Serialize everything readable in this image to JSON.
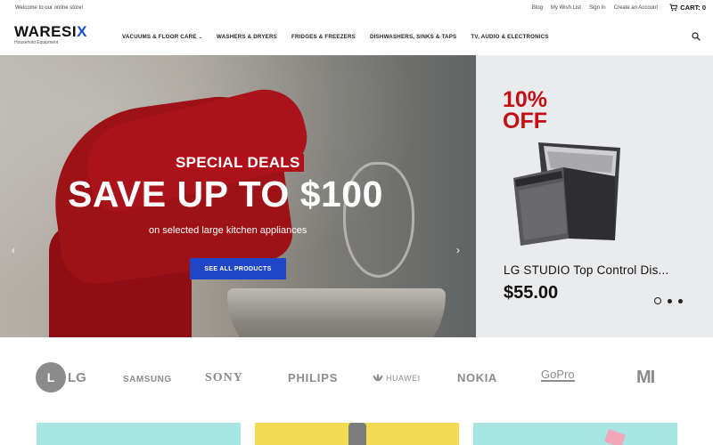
{
  "topbar": {
    "welcome": "Welcome to our online store!",
    "links": [
      "Blog",
      "My Wish List",
      "Sign In",
      "Create an Account"
    ],
    "cart_label": "CART: 0"
  },
  "header": {
    "logo_prefix": "WARESI",
    "logo_x": "X",
    "logo_tagline": "Household Equipment",
    "nav": [
      "VACUUMS & FLOOR CARE",
      "WASHERS & DRYERS",
      "FRIDGES & FREEZERS",
      "DISHWASHERS, SINKS & TAPS",
      "TV, AUDIO & ELECTRONICS"
    ],
    "nav_caret": "⌄"
  },
  "hero": {
    "badge": "SPECIAL DEALS",
    "headline": "SAVE UP TO $100",
    "subline": "on selected large kitchen appliances",
    "cta": "SEE ALL PRODUCTS",
    "prev_arrow": "‹",
    "next_arrow": "›"
  },
  "promo": {
    "discount_line1": "10%",
    "discount_line2": "OFF",
    "product_name": "LG STUDIO Top Control Dis...",
    "price": "$55.00",
    "dots": 3,
    "active_dot": 0
  },
  "brands": {
    "lg": "LG",
    "lg_circle": "L",
    "samsung": "SAMSUNG",
    "sony": "SONY",
    "philips": "PHILIPS",
    "huawei": "HUAWEI",
    "nokia": "NOKIA",
    "gopro": "GoPro",
    "mi": "MI"
  },
  "colors": {
    "accent_blue": "#1f46c7",
    "deal_red": "#b0101a",
    "discount_red": "#c40d14",
    "brand_gray": "#8b8b8b"
  }
}
